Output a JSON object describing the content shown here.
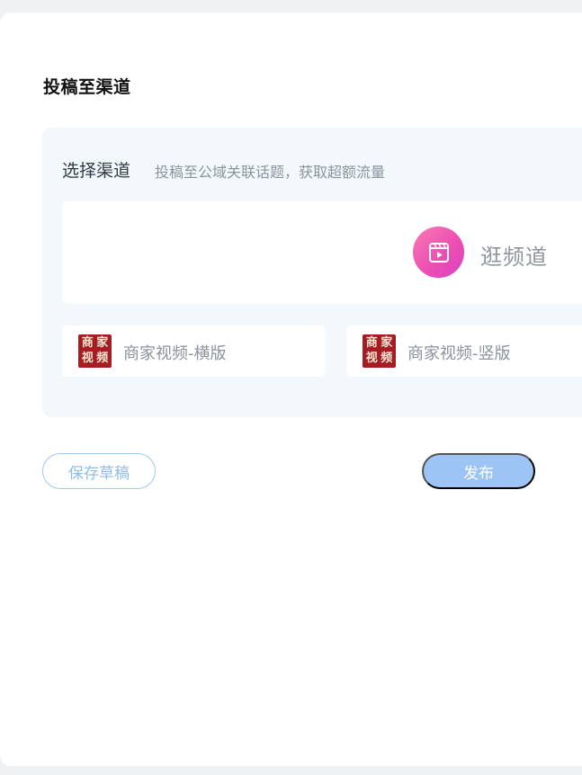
{
  "page": {
    "title": "投稿至渠道"
  },
  "channel_select": {
    "label": "选择渠道",
    "hint": "投稿至公域关联话题，获取超额流量",
    "featured": {
      "label": "逛频道",
      "icon": "video-play-icon",
      "accent": "#ee4fb2"
    },
    "items": [
      {
        "label": "商家视频-横版",
        "icon": "merchant-video-seal-icon",
        "seal_chars": [
          "商",
          "家",
          "视",
          "频"
        ]
      },
      {
        "label": "商家视频-竖版",
        "icon": "merchant-video-seal-icon",
        "seal_chars": [
          "商",
          "家",
          "视",
          "频"
        ]
      }
    ]
  },
  "actions": {
    "save_draft_label": "保存草稿",
    "publish_label": "发布",
    "publish_color": "#9cc5f6"
  }
}
